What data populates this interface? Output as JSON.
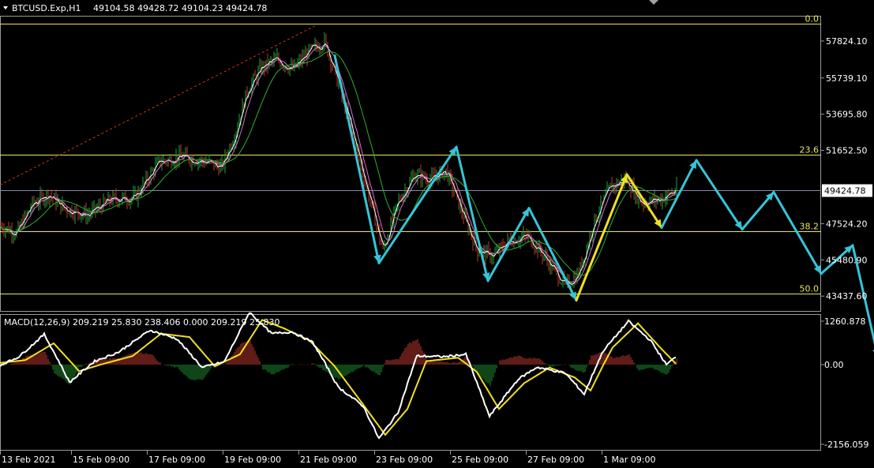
{
  "header": {
    "symbol_label": "BTCUSD.Exp,H1",
    "ohlc_label": "49104.58 49428.72 49104.23 49424.78"
  },
  "macd_header": "MACD(12,26,9) 209.219 25.830 238.406 0.000 209.219 25.830",
  "colors": {
    "background": "#000000",
    "frame": "#9a9a9a",
    "up_candle": "#19a83a",
    "down_candle": "#c0392b",
    "fib_line": "#e8e85a",
    "price_line": "#8a8aaa",
    "trend_dashed": "#d0302a",
    "ma_fast": "#ffffff",
    "ma_mid": "#d070d0",
    "ma_slow": "#2fb02f",
    "projection": "#36c5d8",
    "projection_recent": "#f0e020",
    "macd_main": "#ffffff",
    "macd_signal": "#f0e020",
    "hist_pos": "#c0392b",
    "hist_neg": "#1f8a2f"
  },
  "price_axis_labels": [
    "57824.10",
    "55739.10",
    "53695.80",
    "51652.50",
    "47524.20",
    "45480.90",
    "43437.60"
  ],
  "current_price_label": "49424.78",
  "macd_axis_labels": [
    "1260.878",
    "0.00",
    "-2156.059"
  ],
  "fib_levels": [
    {
      "label": "0.0",
      "price": 58800
    },
    {
      "label": "23.6",
      "price": 51400
    },
    {
      "label": "38.2",
      "price": 47100
    },
    {
      "label": "50.0",
      "price": 43570
    }
  ],
  "time_labels": [
    "13 Feb 2021",
    "15 Feb 09:00",
    "17 Feb 09:00",
    "19 Feb 09:00",
    "21 Feb 09:00",
    "23 Feb 09:00",
    "25 Feb 09:00",
    "27 Feb 09:00",
    "1 Mar 09:00"
  ],
  "chart_data": {
    "type": "candlestick",
    "symbol": "BTCUSD.Exp",
    "timeframe": "H1",
    "current_price": 49424.78,
    "price_range": [
      42600,
      59200
    ],
    "time_range_hours": [
      0,
      465
    ],
    "price_ticks": [
      57824.1,
      55739.1,
      53695.8,
      51652.5,
      47524.2,
      45480.9,
      43437.6
    ],
    "time_ticks_hours": [
      0,
      45,
      93,
      141,
      189,
      237,
      285,
      333,
      381
    ],
    "price_path": [
      [
        0,
        47400
      ],
      [
        10,
        47000
      ],
      [
        20,
        48600
      ],
      [
        30,
        49200
      ],
      [
        40,
        48400
      ],
      [
        55,
        48000
      ],
      [
        70,
        48900
      ],
      [
        85,
        49000
      ],
      [
        100,
        51000
      ],
      [
        115,
        51300
      ],
      [
        130,
        51000
      ],
      [
        140,
        50700
      ],
      [
        148,
        52500
      ],
      [
        156,
        55000
      ],
      [
        165,
        56300
      ],
      [
        175,
        56800
      ],
      [
        185,
        56200
      ],
      [
        195,
        57200
      ],
      [
        205,
        57800
      ],
      [
        210,
        56500
      ],
      [
        220,
        53500
      ],
      [
        232,
        49500
      ],
      [
        242,
        46000
      ],
      [
        252,
        48800
      ],
      [
        262,
        50300
      ],
      [
        272,
        50000
      ],
      [
        282,
        50500
      ],
      [
        292,
        48200
      ],
      [
        302,
        46000
      ],
      [
        312,
        45700
      ],
      [
        322,
        46600
      ],
      [
        334,
        46800
      ],
      [
        345,
        45600
      ],
      [
        358,
        44000
      ],
      [
        366,
        44700
      ],
      [
        376,
        47700
      ],
      [
        386,
        49600
      ],
      [
        396,
        50000
      ],
      [
        406,
        48700
      ],
      [
        418,
        48900
      ],
      [
        428,
        49424.78
      ]
    ],
    "moving_averages": [
      {
        "name": "MA fast",
        "color": "#ffffff",
        "window": 4
      },
      {
        "name": "MA mid",
        "color": "#d070d0",
        "window": 8
      },
      {
        "name": "MA slow",
        "color": "#2fb02f",
        "window": 22
      }
    ],
    "trend_line": {
      "style": "dashed",
      "points": [
        [
          0,
          49700
        ],
        [
          200,
          58700
        ]
      ]
    },
    "projection_path": [
      {
        "t": 212,
        "price": 57000,
        "color": "#36c5d8"
      },
      {
        "t": 240,
        "price": 45300,
        "color": "#36c5d8"
      },
      {
        "t": 289,
        "price": 51850,
        "color": "#36c5d8"
      },
      {
        "t": 309,
        "price": 44300,
        "color": "#36c5d8"
      },
      {
        "t": 335,
        "price": 48400,
        "color": "#36c5d8"
      },
      {
        "t": 365,
        "price": 43200,
        "color": "#36c5d8"
      },
      {
        "t": 397,
        "price": 50300,
        "color": "#f0e020"
      },
      {
        "t": 419,
        "price": 47300,
        "color": "#f0e020"
      },
      {
        "t": 441,
        "price": 51100,
        "color": "#36c5d8"
      },
      {
        "t": 470,
        "price": 47200,
        "color": "#36c5d8"
      },
      {
        "t": 490,
        "price": 49300,
        "color": "#36c5d8"
      },
      {
        "t": 520,
        "price": 44700,
        "color": "#36c5d8"
      },
      {
        "t": 540,
        "price": 46300,
        "color": "#36c5d8"
      },
      {
        "t": 556,
        "price": 40000,
        "color": "#36c5d8"
      }
    ],
    "macd": {
      "parameters": "12,26,9",
      "range": [
        -2156.059,
        1260.878
      ],
      "main_path": [
        [
          0,
          -20
        ],
        [
          12,
          230
        ],
        [
          28,
          880
        ],
        [
          44,
          -480
        ],
        [
          60,
          100
        ],
        [
          75,
          360
        ],
        [
          95,
          1000
        ],
        [
          112,
          750
        ],
        [
          128,
          -80
        ],
        [
          142,
          80
        ],
        [
          158,
          1520
        ],
        [
          172,
          900
        ],
        [
          185,
          950
        ],
        [
          198,
          650
        ],
        [
          214,
          -600
        ],
        [
          230,
          -1120
        ],
        [
          240,
          -2000
        ],
        [
          252,
          -1300
        ],
        [
          264,
          250
        ],
        [
          282,
          230
        ],
        [
          295,
          300
        ],
        [
          310,
          -1400
        ],
        [
          328,
          -400
        ],
        [
          340,
          -70
        ],
        [
          358,
          -230
        ],
        [
          370,
          -800
        ],
        [
          382,
          400
        ],
        [
          398,
          1260
        ],
        [
          412,
          700
        ],
        [
          422,
          0
        ],
        [
          428,
          220
        ]
      ],
      "signal_path": [
        [
          0,
          50
        ],
        [
          16,
          130
        ],
        [
          34,
          620
        ],
        [
          50,
          -180
        ],
        [
          66,
          30
        ],
        [
          84,
          250
        ],
        [
          102,
          900
        ],
        [
          120,
          800
        ],
        [
          136,
          -50
        ],
        [
          152,
          300
        ],
        [
          166,
          1300
        ],
        [
          180,
          1050
        ],
        [
          196,
          700
        ],
        [
          212,
          -50
        ],
        [
          226,
          -850
        ],
        [
          244,
          -1900
        ],
        [
          258,
          -1200
        ],
        [
          270,
          100
        ],
        [
          290,
          200
        ],
        [
          302,
          -200
        ],
        [
          316,
          -1200
        ],
        [
          332,
          -500
        ],
        [
          348,
          -80
        ],
        [
          364,
          -350
        ],
        [
          374,
          -700
        ],
        [
          388,
          500
        ],
        [
          404,
          1200
        ],
        [
          418,
          500
        ],
        [
          428,
          25.83
        ]
      ]
    }
  }
}
